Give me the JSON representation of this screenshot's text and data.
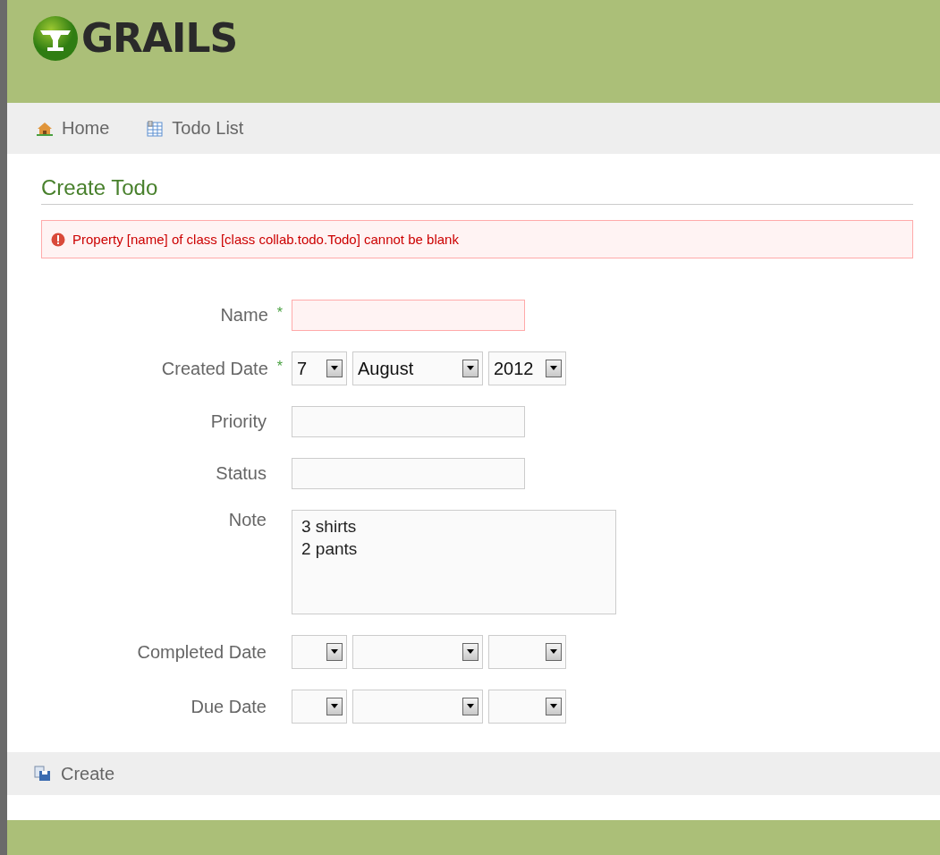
{
  "header": {
    "logo_text": "GRAILS"
  },
  "nav": [
    {
      "label": "Home",
      "kind": "home"
    },
    {
      "label": "Todo List",
      "kind": "list"
    }
  ],
  "page_title": "Create Todo",
  "errors": [
    "Property [name] of class [class collab.todo.Todo] cannot be blank"
  ],
  "fields": [
    {
      "label": "Name",
      "required_mark": "*",
      "kind": "text",
      "error": true
    },
    {
      "label": "Created Date",
      "required_mark": "*",
      "kind": "date",
      "day": "7",
      "month": "August",
      "year": "2012"
    },
    {
      "label": "Priority",
      "kind": "text",
      "error": false
    },
    {
      "label": "Status",
      "kind": "text",
      "error": false
    },
    {
      "label": "Note",
      "kind": "textarea",
      "value": "3 shirts\n2 pants"
    },
    {
      "label": "Completed Date",
      "kind": "date"
    },
    {
      "label": "Due Date",
      "kind": "date"
    }
  ],
  "buttons": [
    {
      "label": "Create"
    }
  ]
}
